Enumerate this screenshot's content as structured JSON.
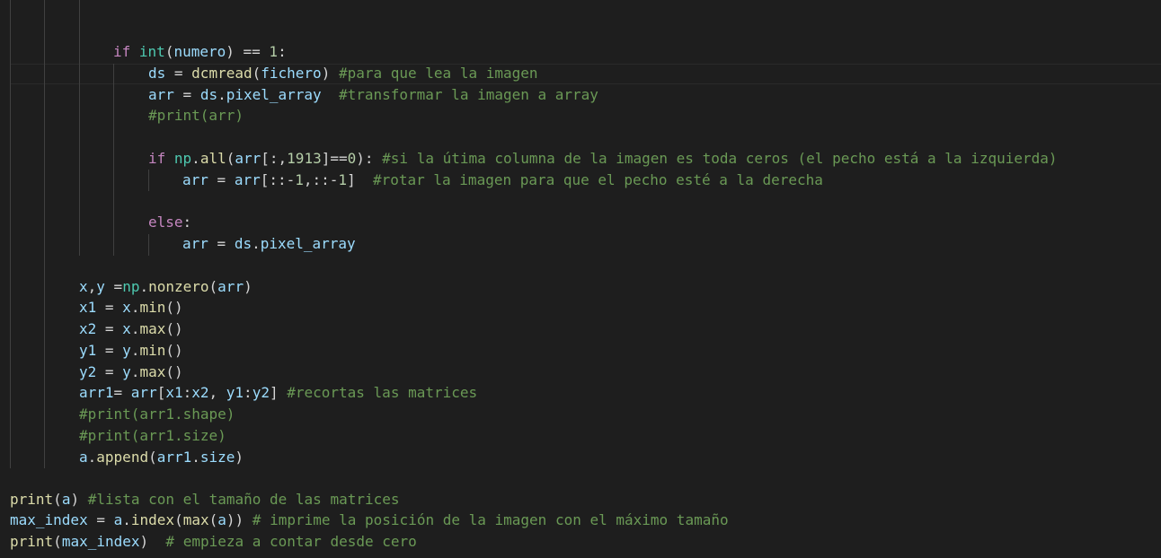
{
  "editor": {
    "language": "python",
    "theme": "dark",
    "colors": {
      "background": "#1e1e1e",
      "keyword": "#c586c0",
      "builtin": "#4ec9b0",
      "function": "#dcdcaa",
      "variable": "#9cdcfe",
      "number": "#b5cea8",
      "comment": "#6a9955"
    },
    "lines": [
      {
        "id": "line-if-numero",
        "tokens": [
          [
            "kw",
            "if "
          ],
          [
            "bi",
            "int"
          ],
          [
            "op",
            "("
          ],
          [
            "var",
            "numero"
          ],
          [
            "op",
            ") == "
          ],
          [
            "num",
            "1"
          ],
          [
            "op",
            ":"
          ]
        ]
      },
      {
        "id": "line-dcmread",
        "tokens": [
          [
            "var",
            "ds"
          ],
          [
            "op",
            " = "
          ],
          [
            "fn",
            "dcmread"
          ],
          [
            "op",
            "("
          ],
          [
            "var",
            "fichero"
          ],
          [
            "op",
            ") "
          ],
          [
            "cm",
            "#para que lea la imagen"
          ]
        ]
      },
      {
        "id": "line-pixel-array",
        "tokens": [
          [
            "var",
            "arr"
          ],
          [
            "op",
            " = "
          ],
          [
            "var",
            "ds"
          ],
          [
            "op",
            "."
          ],
          [
            "var",
            "pixel_array"
          ],
          [
            "op",
            "  "
          ],
          [
            "cm",
            "#transformar la imagen a array"
          ]
        ]
      },
      {
        "id": "line-print-arr",
        "tokens": [
          [
            "cm",
            "#print(arr)"
          ]
        ]
      },
      {
        "id": "line-if-np-all",
        "tokens": [
          [
            "kw",
            "if "
          ],
          [
            "bi",
            "np"
          ],
          [
            "op",
            "."
          ],
          [
            "fn",
            "all"
          ],
          [
            "op",
            "("
          ],
          [
            "var",
            "arr"
          ],
          [
            "op",
            "[:,"
          ],
          [
            "num",
            "1913"
          ],
          [
            "op",
            "]=="
          ],
          [
            "num",
            "0"
          ],
          [
            "op",
            "): "
          ],
          [
            "cm",
            "#si la útima columna de la imagen es toda ceros (el pecho está a la izquierda)"
          ]
        ]
      },
      {
        "id": "line-rotate",
        "tokens": [
          [
            "var",
            "arr"
          ],
          [
            "op",
            " = "
          ],
          [
            "var",
            "arr"
          ],
          [
            "op",
            "[::-"
          ],
          [
            "num",
            "1"
          ],
          [
            "op",
            ",::-"
          ],
          [
            "num",
            "1"
          ],
          [
            "op",
            "]  "
          ],
          [
            "cm",
            "#rotar la imagen para que el pecho esté a la derecha"
          ]
        ]
      },
      {
        "id": "line-else",
        "tokens": [
          [
            "kw",
            "else"
          ],
          [
            "op",
            ":"
          ]
        ]
      },
      {
        "id": "line-arr-else",
        "tokens": [
          [
            "var",
            "arr"
          ],
          [
            "op",
            " = "
          ],
          [
            "var",
            "ds"
          ],
          [
            "op",
            "."
          ],
          [
            "var",
            "pixel_array"
          ]
        ]
      },
      {
        "id": "line-nonzero",
        "tokens": [
          [
            "var",
            "x"
          ],
          [
            "op",
            ","
          ],
          [
            "var",
            "y"
          ],
          [
            "op",
            " ="
          ],
          [
            "bi",
            "np"
          ],
          [
            "op",
            "."
          ],
          [
            "fn",
            "nonzero"
          ],
          [
            "op",
            "("
          ],
          [
            "var",
            "arr"
          ],
          [
            "op",
            ")"
          ]
        ]
      },
      {
        "id": "line-x1",
        "tokens": [
          [
            "var",
            "x1"
          ],
          [
            "op",
            " = "
          ],
          [
            "var",
            "x"
          ],
          [
            "op",
            "."
          ],
          [
            "fn",
            "min"
          ],
          [
            "op",
            "()"
          ]
        ]
      },
      {
        "id": "line-x2",
        "tokens": [
          [
            "var",
            "x2"
          ],
          [
            "op",
            " = "
          ],
          [
            "var",
            "x"
          ],
          [
            "op",
            "."
          ],
          [
            "fn",
            "max"
          ],
          [
            "op",
            "()"
          ]
        ]
      },
      {
        "id": "line-y1",
        "tokens": [
          [
            "var",
            "y1"
          ],
          [
            "op",
            " = "
          ],
          [
            "var",
            "y"
          ],
          [
            "op",
            "."
          ],
          [
            "fn",
            "min"
          ],
          [
            "op",
            "()"
          ]
        ]
      },
      {
        "id": "line-y2",
        "tokens": [
          [
            "var",
            "y2"
          ],
          [
            "op",
            " = "
          ],
          [
            "var",
            "y"
          ],
          [
            "op",
            "."
          ],
          [
            "fn",
            "max"
          ],
          [
            "op",
            "()"
          ]
        ]
      },
      {
        "id": "line-arr1",
        "tokens": [
          [
            "var",
            "arr1"
          ],
          [
            "op",
            "= "
          ],
          [
            "var",
            "arr"
          ],
          [
            "op",
            "["
          ],
          [
            "var",
            "x1"
          ],
          [
            "op",
            ":"
          ],
          [
            "var",
            "x2"
          ],
          [
            "op",
            ", "
          ],
          [
            "var",
            "y1"
          ],
          [
            "op",
            ":"
          ],
          [
            "var",
            "y2"
          ],
          [
            "op",
            "] "
          ],
          [
            "cm",
            "#recortas las matrices"
          ]
        ]
      },
      {
        "id": "line-print-shape",
        "tokens": [
          [
            "cm",
            "#print(arr1.shape)"
          ]
        ]
      },
      {
        "id": "line-print-size",
        "tokens": [
          [
            "cm",
            "#print(arr1.size)"
          ]
        ]
      },
      {
        "id": "line-append",
        "tokens": [
          [
            "var",
            "a"
          ],
          [
            "op",
            "."
          ],
          [
            "fn",
            "append"
          ],
          [
            "op",
            "("
          ],
          [
            "var",
            "arr1"
          ],
          [
            "op",
            "."
          ],
          [
            "var",
            "size"
          ],
          [
            "op",
            ")"
          ]
        ]
      },
      {
        "id": "line-print-a",
        "tokens": [
          [
            "fn",
            "print"
          ],
          [
            "op",
            "("
          ],
          [
            "var",
            "a"
          ],
          [
            "op",
            ") "
          ],
          [
            "cm",
            "#lista con el tamaño de las matrices"
          ]
        ]
      },
      {
        "id": "line-max-index",
        "tokens": [
          [
            "var",
            "max_index"
          ],
          [
            "op",
            " = "
          ],
          [
            "var",
            "a"
          ],
          [
            "op",
            "."
          ],
          [
            "fn",
            "index"
          ],
          [
            "op",
            "("
          ],
          [
            "fn",
            "max"
          ],
          [
            "op",
            "("
          ],
          [
            "var",
            "a"
          ],
          [
            "op",
            ")) "
          ],
          [
            "cm",
            "# imprime la posición de la imagen con el máximo tamaño"
          ]
        ]
      },
      {
        "id": "line-print-max-index",
        "tokens": [
          [
            "fn",
            "print"
          ],
          [
            "op",
            "("
          ],
          [
            "var",
            "max_index"
          ],
          [
            "op",
            ")  "
          ],
          [
            "cm",
            "# empieza a contar desde cero"
          ]
        ]
      }
    ]
  }
}
